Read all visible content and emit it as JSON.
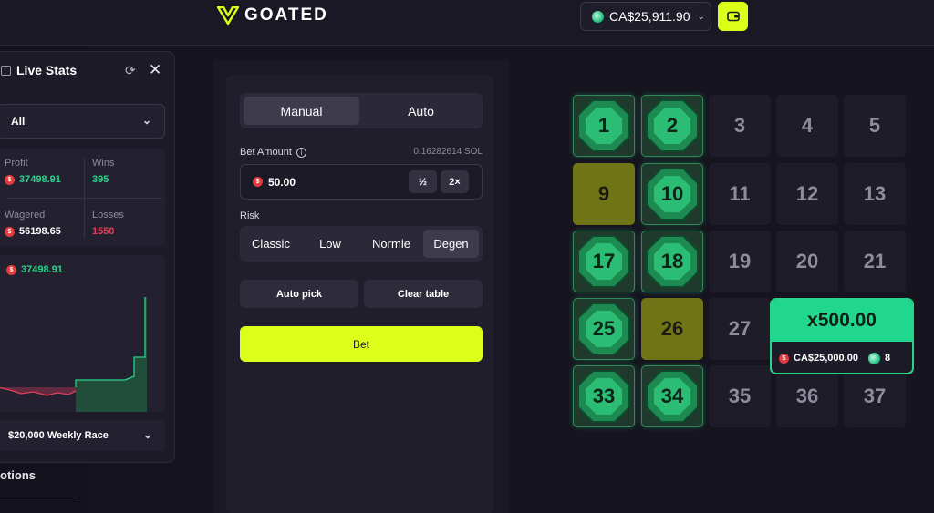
{
  "header": {
    "logo_text": "GOATED",
    "balance": "CA$25,911.90",
    "colors": {
      "accent": "#dcff1a",
      "win": "#21d78d",
      "loss": "#e2405a"
    }
  },
  "live_stats": {
    "title": "Live Stats",
    "filter": "All",
    "profit_label": "Profit",
    "profit_value": "37498.91",
    "wins_label": "Wins",
    "wins_value": "395",
    "wagered_label": "Wagered",
    "wagered_value": "56198.65",
    "losses_label": "Losses",
    "losses_value": "1550",
    "chart_value": "37498.91",
    "race_label": "$20,000 Weekly Race",
    "options_label": "otions"
  },
  "bet_panel": {
    "tabs": [
      "Manual",
      "Auto"
    ],
    "active_tab": "Manual",
    "bet_amount_label": "Bet Amount",
    "bet_amount_sol": "0.16282614 SOL",
    "bet_amount_value": "50.00",
    "half_label": "½",
    "double_label": "2×",
    "risk_label": "Risk",
    "risk_options": [
      "Classic",
      "Low",
      "Normie",
      "Degen"
    ],
    "active_risk": "Degen",
    "auto_pick_label": "Auto pick",
    "clear_table_label": "Clear table",
    "bet_label": "Bet"
  },
  "board": {
    "tiles": [
      {
        "n": "1",
        "state": "gem"
      },
      {
        "n": "2",
        "state": "gem"
      },
      {
        "n": "3",
        "state": "plain"
      },
      {
        "n": "4",
        "state": "plain"
      },
      {
        "n": "5",
        "state": "plain"
      },
      {
        "n": "9",
        "state": "selected"
      },
      {
        "n": "10",
        "state": "gem"
      },
      {
        "n": "11",
        "state": "plain"
      },
      {
        "n": "12",
        "state": "plain"
      },
      {
        "n": "13",
        "state": "plain"
      },
      {
        "n": "17",
        "state": "gem"
      },
      {
        "n": "18",
        "state": "gem"
      },
      {
        "n": "19",
        "state": "plain"
      },
      {
        "n": "20",
        "state": "plain"
      },
      {
        "n": "21",
        "state": "plain"
      },
      {
        "n": "25",
        "state": "gem"
      },
      {
        "n": "26",
        "state": "selected"
      },
      {
        "n": "27",
        "state": "plain"
      },
      {
        "n": "33",
        "state": "gem"
      },
      {
        "n": "34",
        "state": "gem"
      },
      {
        "n": "35",
        "state": "plain"
      },
      {
        "n": "36",
        "state": "plain"
      },
      {
        "n": "37",
        "state": "plain"
      }
    ]
  },
  "payout_tooltip": {
    "multiplier": "x500.00",
    "amount": "CA$25,000.00",
    "hits": "8"
  }
}
